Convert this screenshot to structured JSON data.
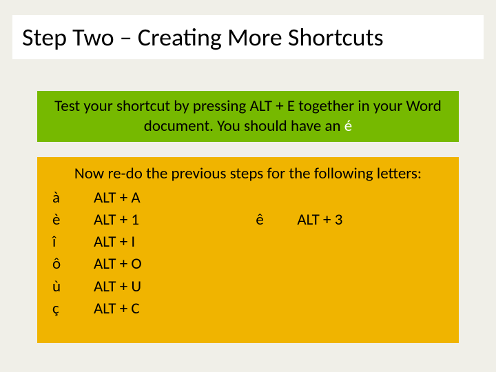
{
  "title": "Step Two – Creating More Shortcuts",
  "test": {
    "text_main": "Test your shortcut by pressing ALT + E together in your Word document. You should have an ",
    "accent_char": "é"
  },
  "redo": {
    "heading": "Now re-do the previous steps for the following letters:",
    "left": [
      {
        "char": "à",
        "shortcut": "ALT + A"
      },
      {
        "char": "è",
        "shortcut": "ALT + 1"
      },
      {
        "char": "î",
        "shortcut": "ALT + I"
      },
      {
        "char": "ô",
        "shortcut": "ALT + O"
      },
      {
        "char": "ù",
        "shortcut": "ALT + U"
      },
      {
        "char": "ç",
        "shortcut": "ALT + C"
      }
    ],
    "right": [
      {
        "char": "ê",
        "shortcut": "ALT + 3"
      }
    ]
  }
}
